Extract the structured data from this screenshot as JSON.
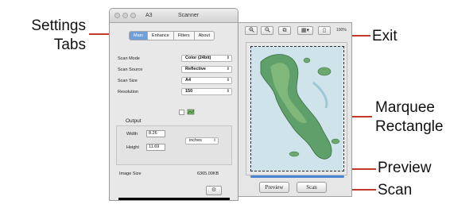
{
  "callouts": {
    "settings_tabs_1": "Settings",
    "settings_tabs_2": "Tabs",
    "exit": "Exit",
    "marquee_1": "Marquee",
    "marquee_2": "Rectangle",
    "preview": "Preview",
    "scan": "Scan"
  },
  "window": {
    "title_left": "A3",
    "title_right": "Scanner"
  },
  "tabs": [
    "Main",
    "Enhance",
    "Filters",
    "About"
  ],
  "settings": {
    "scan_mode_label": "Scan Mode",
    "scan_mode_value": "Color (24bit)",
    "scan_source_label": "Scan Source",
    "scan_source_value": "Reflective",
    "scan_size_label": "Scan Size",
    "scan_size_value": "A4",
    "resolution_label": "Resolution",
    "resolution_value": "150"
  },
  "output": {
    "label": "Output",
    "width_label": "Width",
    "width_value": "8.26",
    "height_label": "Height",
    "height_value": "11.69",
    "unit_value": "inches",
    "image_size_label": "Image Size",
    "image_size_value": "6365.00KB"
  },
  "preview": {
    "zoom": "100%",
    "preview_button": "Preview",
    "scan_button": "Scan"
  },
  "colors": {
    "callout_line": "#c0392b",
    "tab_active": "#6f9fd9",
    "sea": "#cfe3ea",
    "land": "#5f9f6a",
    "progress_bar": "#000000",
    "scroll_thumb": "#4a85d4"
  }
}
